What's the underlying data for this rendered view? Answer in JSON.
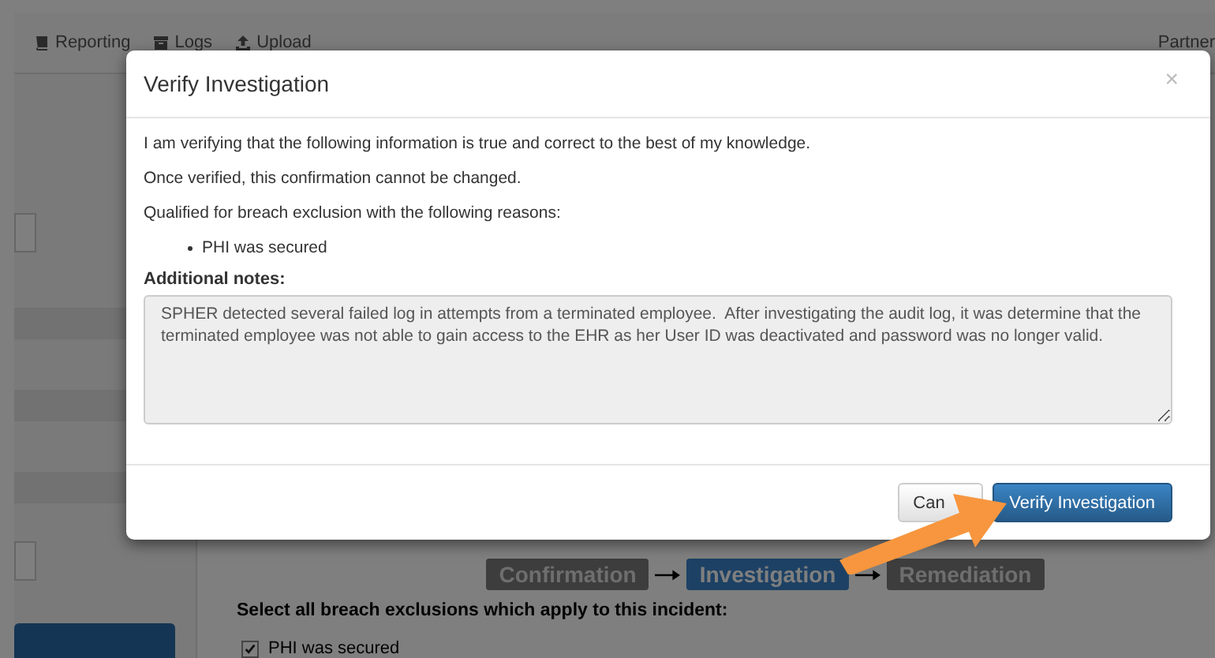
{
  "nav": {
    "items": [
      "Reporting",
      "Logs",
      "Upload"
    ],
    "user": "Partner"
  },
  "steps": [
    {
      "label": "Confirmation",
      "selected": false
    },
    {
      "label": "Investigation",
      "selected": true
    },
    {
      "label": "Remediation",
      "selected": false
    }
  ],
  "exclusions": {
    "prompt": "Select all breach exclusions which apply to this incident:",
    "options": [
      {
        "label": "PHI was secured",
        "checked": true
      }
    ]
  },
  "modal": {
    "title": "Verify Investigation",
    "close": "×",
    "paragraphs": [
      "I am verifying that the following information is true and correct to the best of my knowledge.",
      "Once verified, this confirmation cannot be changed.",
      "Qualified for breach exclusion with the following reasons:"
    ],
    "reasons": [
      "PHI was secured"
    ],
    "notes_label": "Additional notes:",
    "notes": "SPHER detected several failed log in attempts from a terminated employee.  After investigating the audit log, it was determine that the terminated employee was not able to gain access to the EHR as her User ID was deactivated and password was no longer valid.",
    "buttons": [
      {
        "label": "Can",
        "kind": "default"
      },
      {
        "label": "Verify Investigation",
        "kind": "primary"
      }
    ]
  }
}
